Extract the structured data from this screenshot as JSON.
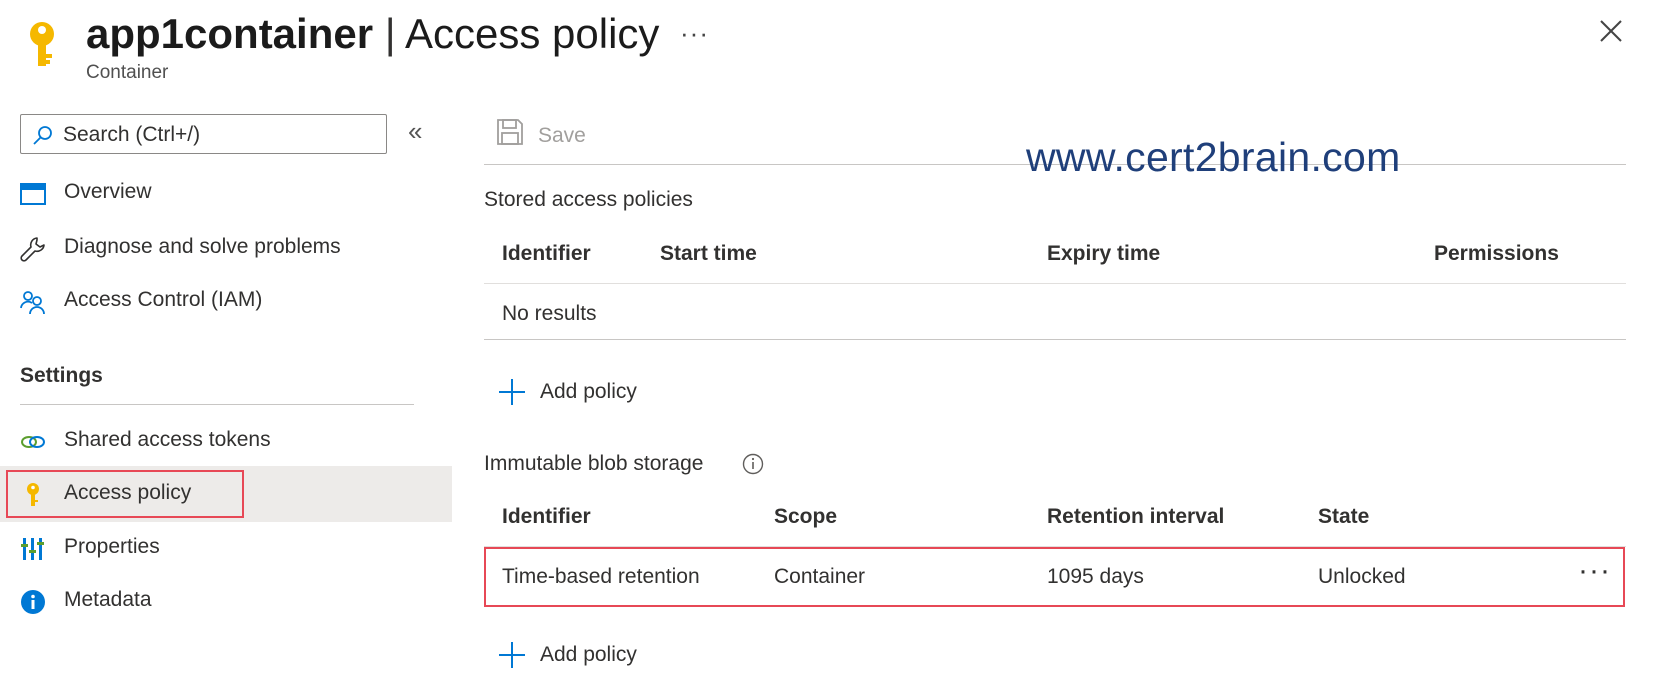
{
  "header": {
    "resource_name": "app1container",
    "separator": " | ",
    "blade_title": "Access policy",
    "subtitle": "Container",
    "more_label": "···",
    "close_label": "Close"
  },
  "sidebar": {
    "search_placeholder": "Search (Ctrl+/)",
    "collapse_label": "«",
    "items": [
      {
        "label": "Overview",
        "icon": "overview-icon"
      },
      {
        "label": "Diagnose and solve problems",
        "icon": "wrench-icon"
      },
      {
        "label": "Access Control (IAM)",
        "icon": "people-icon"
      }
    ],
    "settings_heading": "Settings",
    "settings_items": [
      {
        "label": "Shared access tokens",
        "icon": "link-icon"
      },
      {
        "label": "Access policy",
        "icon": "key-icon",
        "selected": true
      },
      {
        "label": "Properties",
        "icon": "properties-icon"
      },
      {
        "label": "Metadata",
        "icon": "info-icon"
      }
    ]
  },
  "toolbar": {
    "save_label": "Save"
  },
  "watermark": "www.cert2brain.com",
  "stored_policies": {
    "title": "Stored access policies",
    "columns": [
      "Identifier",
      "Start time",
      "Expiry time",
      "Permissions"
    ],
    "empty_text": "No results",
    "add_label": "Add policy"
  },
  "immutable": {
    "title": "Immutable blob storage",
    "columns": [
      "Identifier",
      "Scope",
      "Retention interval",
      "State"
    ],
    "rows": [
      {
        "identifier": "Time-based retention",
        "scope": "Container",
        "retention": "1095 days",
        "state": "Unlocked"
      }
    ],
    "row_more": "···",
    "add_label": "Add policy"
  },
  "colors": {
    "key_yellow": "#f5b800",
    "accent_blue": "#0078d4",
    "highlight_red": "#e74856",
    "watermark_blue": "#1f3f7a"
  }
}
